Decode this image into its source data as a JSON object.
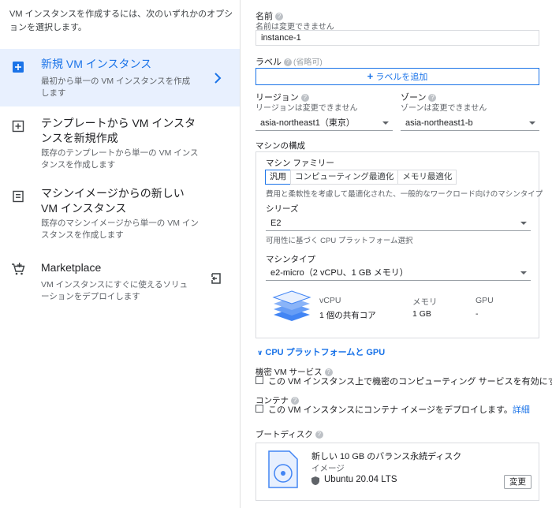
{
  "left": {
    "intro": "VM インスタンスを作成するには、次のいずれかのオプションを選択します。",
    "options": [
      {
        "title": "新規 VM インスタンス",
        "desc": "最初から単一の VM インスタンスを作成します",
        "icon": "add-box-icon"
      },
      {
        "title": "テンプレートから VM インスタンスを新規作成",
        "desc": "既存のテンプレートから単一の VM インスタンスを作成します",
        "icon": "template-add-icon"
      },
      {
        "title": "マシンイメージからの新しい VM インスタンス",
        "desc": "既存のマシンイメージから単一の VM インスタンスを作成します",
        "icon": "machine-image-icon"
      },
      {
        "title": "Marketplace",
        "desc": "VM インスタンスにすぐに使えるソリューションをデプロイします",
        "icon": "cart-add-icon"
      }
    ]
  },
  "form": {
    "name_label": "名前",
    "name_sub": "名前は変更できません",
    "name_value": "instance-1",
    "labels_label": "ラベル",
    "labels_optional": "(省略可)",
    "add_label": "ラベルを追加",
    "region_label": "リージョン",
    "region_sub": "リージョンは変更できません",
    "region_value": "asia-northeast1（東京）",
    "zone_label": "ゾーン",
    "zone_sub": "ゾーンは変更できません",
    "zone_value": "asia-northeast1-b",
    "machine_config_label": "マシンの構成",
    "machine_family_label": "マシン ファミリー",
    "tabs": [
      "汎用",
      "コンピューティング最適化",
      "メモリ最適化"
    ],
    "family_desc": "費用と柔軟性を考慮して最適化された、一般的なワークロード向けのマシンタイプ",
    "series_label": "シリーズ",
    "series_value": "E2",
    "series_desc": "可用性に基づく CPU プラットフォーム選択",
    "machine_type_label": "マシンタイプ",
    "machine_type_value": "e2-micro（2 vCPU、1 GB メモリ）",
    "spec_headers": [
      "vCPU",
      "メモリ",
      "GPU"
    ],
    "spec_values": [
      "1 個の共有コア",
      "1 GB",
      "-"
    ],
    "cpu_platform_link": "CPU プラットフォームと GPU",
    "confidential_label": "機密 VM サービス",
    "confidential_cb": "この VM インスタンス上で機密のコンピューティング サービスを有効にする",
    "container_label": "コンテナ",
    "container_cb": "この VM インスタンスにコンテナ イメージをデプロイします。",
    "container_link": "詳細",
    "boot_disk_label": "ブートディスク",
    "disk_title": "新しい 10 GB のバランス永続ディスク",
    "disk_image_label": "イメージ",
    "disk_image_value": "Ubuntu 20.04 LTS",
    "change_button": "変更"
  },
  "colors": {
    "accent": "#1a73e8",
    "selected_bg": "#e8f0fe"
  }
}
